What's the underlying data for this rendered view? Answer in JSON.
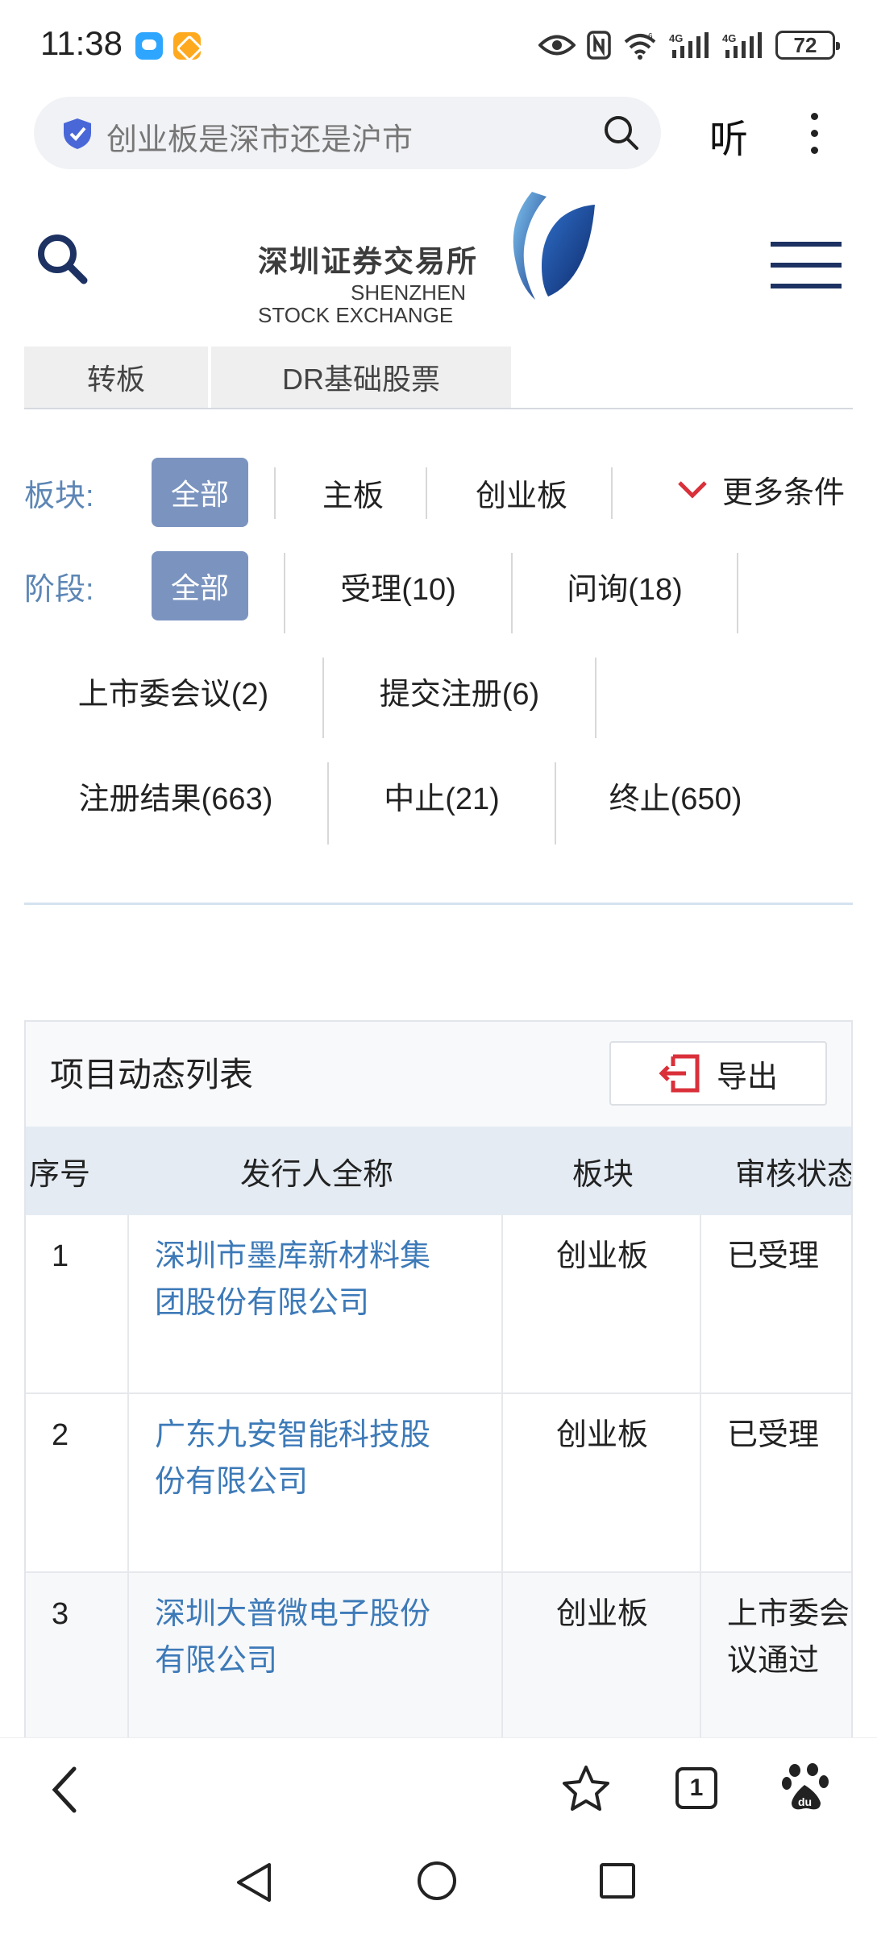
{
  "status_bar": {
    "time": "11:38",
    "battery": "72",
    "icons": [
      "message-app-icon",
      "note-app-icon",
      "eye-icon",
      "nfc-icon",
      "wifi-icon",
      "signal-4g-icon",
      "signal-4g-icon",
      "battery-icon"
    ]
  },
  "browser": {
    "search_text": "创业板是深市还是沪市",
    "listen_label": "听"
  },
  "site": {
    "logo_cn": "深圳证券交易所",
    "logo_en_line1": "SHENZHEN",
    "logo_en_line2": "STOCK EXCHANGE",
    "tabs": [
      {
        "label": "转板"
      },
      {
        "label": "DR基础股票"
      }
    ]
  },
  "filters": {
    "sector_label": "板块:",
    "sector_options": [
      {
        "label": "全部",
        "selected": true
      },
      {
        "label": "主板",
        "selected": false
      },
      {
        "label": "创业板",
        "selected": false
      }
    ],
    "more_conditions": "更多条件",
    "stage_label": "阶段:",
    "stage_options": [
      {
        "label": "全部",
        "selected": true
      },
      {
        "label": "受理(10)",
        "selected": false
      },
      {
        "label": "问询(18)",
        "selected": false
      },
      {
        "label": "上市委会议(2)",
        "selected": false
      },
      {
        "label": "提交注册(6)",
        "selected": false
      },
      {
        "label": "注册结果(663)",
        "selected": false
      },
      {
        "label": "中止(21)",
        "selected": false
      },
      {
        "label": "终止(650)",
        "selected": false
      }
    ]
  },
  "project_list": {
    "title": "项目动态列表",
    "export_label": "导出",
    "columns": [
      "序号",
      "发行人全称",
      "板块",
      "审核状态"
    ],
    "rows": [
      {
        "index": "1",
        "issuer_line1": "深圳市墨库新材料集",
        "issuer_line2": "团股份有限公司",
        "sector": "创业板",
        "status_line1": "已受理",
        "status_line2": ""
      },
      {
        "index": "2",
        "issuer_line1": "广东九安智能科技股",
        "issuer_line2": "份有限公司",
        "sector": "创业板",
        "status_line1": "已受理",
        "status_line2": ""
      },
      {
        "index": "3",
        "issuer_line1": "深圳大普微电子股份",
        "issuer_line2": "有限公司",
        "sector": "创业板",
        "status_line1": "上市委会",
        "status_line2": "议通过"
      }
    ]
  },
  "bottom_bar": {
    "tab_count": "1"
  },
  "colors": {
    "link": "#3d7ab8",
    "label_blue": "#5d86b5",
    "selected_pill": "#7b94bf",
    "brand_navy": "#1d3262",
    "export_red": "#d9303a"
  }
}
